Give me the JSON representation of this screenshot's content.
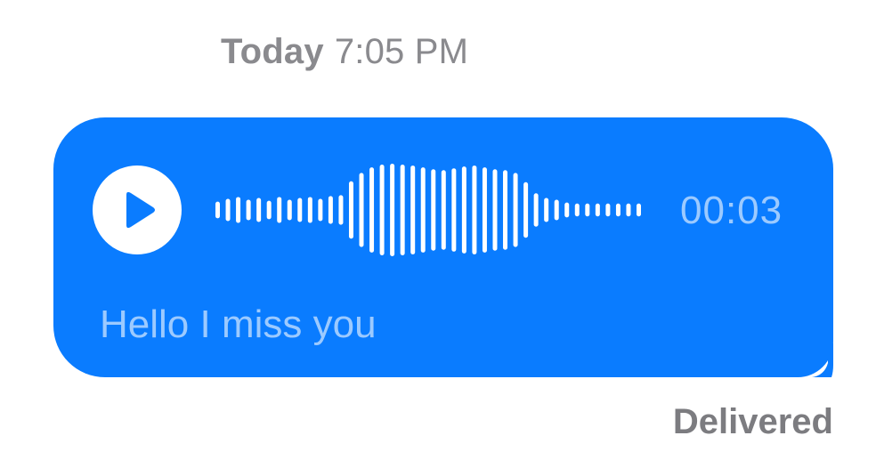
{
  "message": {
    "timestamp_day": "Today",
    "timestamp_time": "7:05 PM",
    "audio": {
      "duration": "00:03",
      "play_icon": "play-icon",
      "waveform_levels": [
        0.18,
        0.24,
        0.28,
        0.22,
        0.26,
        0.2,
        0.28,
        0.22,
        0.26,
        0.28,
        0.24,
        0.3,
        0.32,
        0.62,
        0.8,
        0.92,
        0.98,
        1.0,
        0.98,
        0.96,
        0.92,
        0.88,
        0.86,
        0.9,
        0.94,
        0.96,
        0.92,
        0.88,
        0.86,
        0.8,
        0.6,
        0.36,
        0.26,
        0.22,
        0.16,
        0.14,
        0.14,
        0.14,
        0.14,
        0.14,
        0.14,
        0.14
      ]
    },
    "transcript": "Hello I miss you",
    "status": "Delivered"
  },
  "colors": {
    "bubble": "#0a7cff",
    "waveform": "#ffffff",
    "secondary_text": "#9ccaff",
    "timestamp": "#8a8a8e",
    "status": "#7c7c80"
  }
}
